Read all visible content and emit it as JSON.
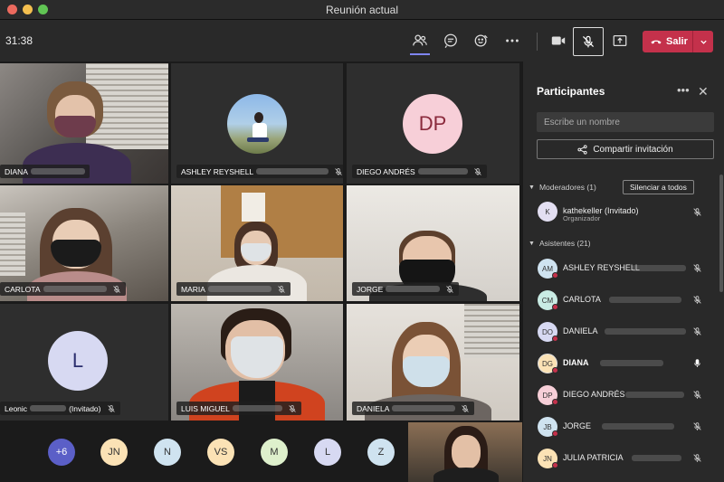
{
  "window": {
    "title": "Reunión actual"
  },
  "toolbar": {
    "timer": "31:38",
    "leave_label": "Salir"
  },
  "tiles": [
    {
      "name": "DIANA"
    },
    {
      "name": "ASHLEY REYSHELL"
    },
    {
      "name": "DIEGO ANDRÉS",
      "initials": "DP"
    },
    {
      "name": "CARLOTA"
    },
    {
      "name": "MARIA"
    },
    {
      "name": "JORGE"
    },
    {
      "name": "Leonic",
      "suffix": "(Invitado)",
      "initials": "L"
    },
    {
      "name": "LUIS MIGUEL"
    },
    {
      "name": "DANIELA"
    }
  ],
  "roster": [
    {
      "label": "+6",
      "color": "#5b5fc7"
    },
    {
      "label": "JN",
      "color": "#fbe2b5"
    },
    {
      "label": "N",
      "color": "#cfe3f0"
    },
    {
      "label": "VS",
      "color": "#fbe2b5"
    },
    {
      "label": "M",
      "color": "#def0cc"
    },
    {
      "label": "L",
      "color": "#d7d9f2"
    },
    {
      "label": "Z",
      "color": "#cfe3f0"
    }
  ],
  "panel": {
    "title": "Participantes",
    "search_placeholder": "Escribe un nombre",
    "share_label": "Compartir invitación",
    "moderators_label": "Moderadores (1)",
    "mute_all_label": "Silenciar a todos",
    "attendees_label": "Asistentes (21)",
    "moderators": [
      {
        "initials": "K",
        "name": "kathekeller (Invitado)",
        "role": "Organizador",
        "color": "#e3dff2"
      }
    ],
    "attendees": [
      {
        "initials": "AM",
        "name": "ASHLEY REYSHELL",
        "color": "#cfe3f0",
        "mic": "off"
      },
      {
        "initials": "CM",
        "name": "CARLOTA",
        "color": "#c9ece4",
        "mic": "off"
      },
      {
        "initials": "DO",
        "name": "DANIELA",
        "color": "#d7d9f2",
        "mic": "off"
      },
      {
        "initials": "DG",
        "name": "DIANA",
        "color": "#fbe2b5",
        "mic": "on"
      },
      {
        "initials": "DP",
        "name": "DIEGO ANDRÉS",
        "color": "#f7cfd8",
        "mic": "off"
      },
      {
        "initials": "JB",
        "name": "JORGE",
        "color": "#cfe3f0",
        "mic": "off"
      },
      {
        "initials": "JN",
        "name": "JULIA PATRICIA",
        "color": "#fbe2b5",
        "mic": "off"
      }
    ]
  }
}
